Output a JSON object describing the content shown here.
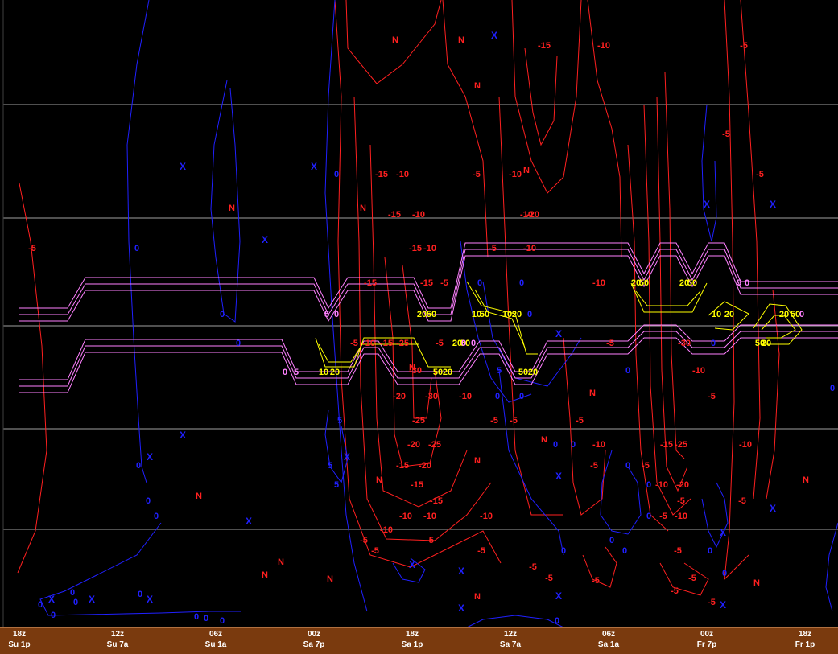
{
  "chart_data": {
    "type": "contour",
    "time_axis": [
      {
        "utc": "18z",
        "local": "Su 1p"
      },
      {
        "utc": "12z",
        "local": "Su 7a"
      },
      {
        "utc": "06z",
        "local": "Su 1a"
      },
      {
        "utc": "00z",
        "local": "Sa 7p"
      },
      {
        "utc": "18z",
        "local": "Sa 1p"
      },
      {
        "utc": "12z",
        "local": "Sa 7a"
      },
      {
        "utc": "06z",
        "local": "Sa 1a"
      },
      {
        "utc": "00z",
        "local": "Fr 7p"
      },
      {
        "utc": "18z",
        "local": "Fr 1p"
      }
    ],
    "red_contour_labels": [
      "-5",
      "-10",
      "-15",
      "-20",
      "-25",
      "-30"
    ],
    "blue_contour_labels": [
      "0",
      "5"
    ],
    "yellow_contour_labels": [
      "10",
      "20",
      "50"
    ],
    "pink_contour_labels": [
      "0",
      "5"
    ],
    "marker_labels": {
      "negative_center": "N",
      "positive_center": "X"
    },
    "colors": {
      "background": "#000000",
      "red_contours": "#ff2020",
      "blue_contours": "#2020ff",
      "yellow_contours": "#ffff00",
      "pink_contours": "#ff80ff",
      "gridlines": "#a0a0a0",
      "time_bar": "#7a3a0e"
    }
  }
}
